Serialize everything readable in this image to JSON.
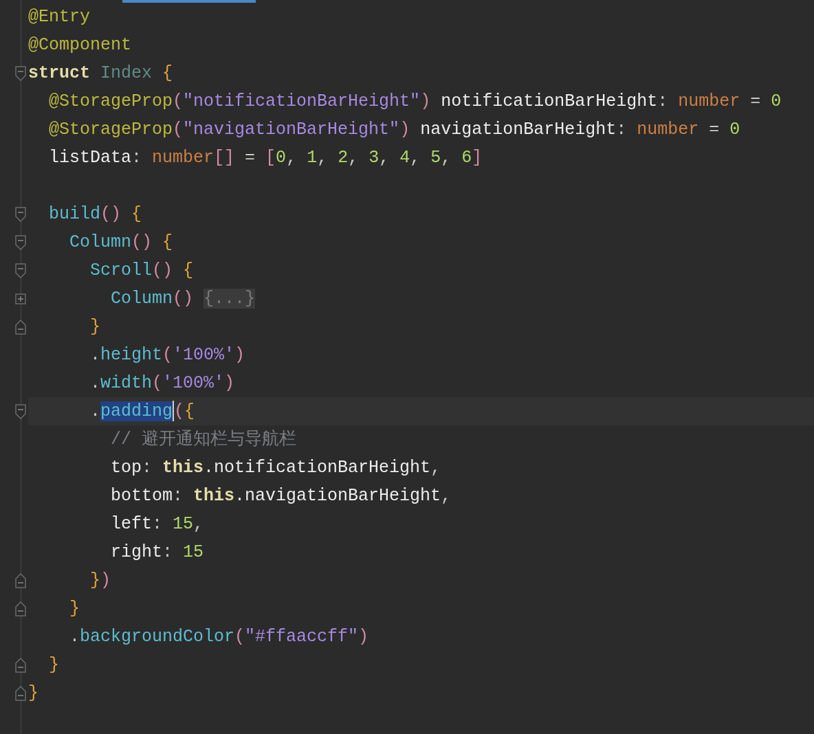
{
  "editor": {
    "lines": [
      {
        "kind": "plain",
        "current": false,
        "tokens": [
          {
            "text": "@Entry",
            "kind": "annotation"
          }
        ]
      },
      {
        "kind": "plain",
        "current": false,
        "tokens": [
          {
            "text": "@Component",
            "kind": "annotation"
          }
        ]
      },
      {
        "kind": "foldstart",
        "current": false,
        "tokens": [
          {
            "text": "struct",
            "kind": "keyword"
          },
          {
            "text": " Index ",
            "kind": "class"
          },
          {
            "text": "{",
            "kind": "brace"
          }
        ]
      },
      {
        "kind": "plain",
        "current": false,
        "tokens": [
          {
            "text": "  @StorageProp",
            "kind": "annotation"
          },
          {
            "text": "(",
            "kind": "paren"
          },
          {
            "text": "\"notificationBarHeight\"",
            "kind": "string"
          },
          {
            "text": ")",
            "kind": "paren"
          },
          {
            "text": " notificationBarHeight",
            "kind": "ident"
          },
          {
            "text": ": ",
            "kind": "punct"
          },
          {
            "text": "number",
            "kind": "type"
          },
          {
            "text": " = ",
            "kind": "punct"
          },
          {
            "text": "0",
            "kind": "number"
          }
        ]
      },
      {
        "kind": "plain",
        "current": false,
        "tokens": [
          {
            "text": "  @StorageProp",
            "kind": "annotation"
          },
          {
            "text": "(",
            "kind": "paren"
          },
          {
            "text": "\"navigationBarHeight\"",
            "kind": "string"
          },
          {
            "text": ")",
            "kind": "paren"
          },
          {
            "text": " navigationBarHeight",
            "kind": "ident"
          },
          {
            "text": ": ",
            "kind": "punct"
          },
          {
            "text": "number",
            "kind": "type"
          },
          {
            "text": " = ",
            "kind": "punct"
          },
          {
            "text": "0",
            "kind": "number"
          }
        ]
      },
      {
        "kind": "plain",
        "current": false,
        "tokens": [
          {
            "text": "  listData",
            "kind": "ident"
          },
          {
            "text": ": ",
            "kind": "punct"
          },
          {
            "text": "number",
            "kind": "type"
          },
          {
            "text": "[]",
            "kind": "paren"
          },
          {
            "text": " = ",
            "kind": "punct"
          },
          {
            "text": "[",
            "kind": "paren"
          },
          {
            "text": "0",
            "kind": "number"
          },
          {
            "text": ", ",
            "kind": "punct"
          },
          {
            "text": "1",
            "kind": "number"
          },
          {
            "text": ", ",
            "kind": "punct"
          },
          {
            "text": "2",
            "kind": "number"
          },
          {
            "text": ", ",
            "kind": "punct"
          },
          {
            "text": "3",
            "kind": "number"
          },
          {
            "text": ", ",
            "kind": "punct"
          },
          {
            "text": "4",
            "kind": "number"
          },
          {
            "text": ", ",
            "kind": "punct"
          },
          {
            "text": "5",
            "kind": "number"
          },
          {
            "text": ", ",
            "kind": "punct"
          },
          {
            "text": "6",
            "kind": "number"
          },
          {
            "text": "]",
            "kind": "paren"
          }
        ]
      },
      {
        "kind": "plain"
      },
      {
        "kind": "foldstart",
        "current": false,
        "tokens": [
          {
            "text": "  build",
            "kind": "function"
          },
          {
            "text": "()",
            "kind": "paren"
          },
          {
            "text": " {",
            "kind": "brace"
          }
        ]
      },
      {
        "kind": "foldstart",
        "current": false,
        "tokens": [
          {
            "text": "    Column",
            "kind": "function"
          },
          {
            "text": "()",
            "kind": "paren"
          },
          {
            "text": " {",
            "kind": "brace"
          }
        ]
      },
      {
        "kind": "foldstart",
        "current": false,
        "tokens": [
          {
            "text": "      Scroll",
            "kind": "function"
          },
          {
            "text": "()",
            "kind": "paren"
          },
          {
            "text": " {",
            "kind": "brace"
          }
        ]
      },
      {
        "kind": "collapsed",
        "current": false,
        "tokens": [
          {
            "text": "        Column",
            "kind": "function"
          },
          {
            "text": "() ",
            "kind": "paren"
          },
          {
            "text": "{...}",
            "kind": "folded"
          }
        ]
      },
      {
        "kind": "foldend",
        "current": false,
        "tokens": [
          {
            "text": "      }",
            "kind": "brace"
          }
        ]
      },
      {
        "kind": "plain",
        "current": false,
        "tokens": [
          {
            "text": "      .",
            "kind": "punct"
          },
          {
            "text": "height",
            "kind": "function"
          },
          {
            "text": "(",
            "kind": "paren"
          },
          {
            "text": "'100%'",
            "kind": "string"
          },
          {
            "text": ")",
            "kind": "paren"
          }
        ]
      },
      {
        "kind": "plain",
        "current": false,
        "tokens": [
          {
            "text": "      .",
            "kind": "punct"
          },
          {
            "text": "width",
            "kind": "function"
          },
          {
            "text": "(",
            "kind": "paren"
          },
          {
            "text": "'100%'",
            "kind": "string"
          },
          {
            "text": ")",
            "kind": "paren"
          }
        ]
      },
      {
        "kind": "foldstart",
        "current": true,
        "tokens": [
          {
            "text": "      .",
            "kind": "punct"
          },
          {
            "text": "padding",
            "kind": "selection"
          },
          {
            "text": "(",
            "kind": "paren"
          },
          {
            "text": "{",
            "kind": "brace"
          }
        ]
      },
      {
        "kind": "plain",
        "current": false,
        "tokens": [
          {
            "text": "        // 避开通知栏与导航栏",
            "kind": "comment"
          }
        ]
      },
      {
        "kind": "plain",
        "current": false,
        "tokens": [
          {
            "text": "        top",
            "kind": "ident"
          },
          {
            "text": ": ",
            "kind": "punct"
          },
          {
            "text": "this",
            "kind": "keyword"
          },
          {
            "text": ".notificationBarHeight",
            "kind": "ident"
          },
          {
            "text": ",",
            "kind": "punct"
          }
        ]
      },
      {
        "kind": "plain",
        "current": false,
        "tokens": [
          {
            "text": "        bottom",
            "kind": "ident"
          },
          {
            "text": ": ",
            "kind": "punct"
          },
          {
            "text": "this",
            "kind": "keyword"
          },
          {
            "text": ".navigationBarHeight",
            "kind": "ident"
          },
          {
            "text": ",",
            "kind": "punct"
          }
        ]
      },
      {
        "kind": "plain",
        "current": false,
        "tokens": [
          {
            "text": "        left",
            "kind": "ident"
          },
          {
            "text": ": ",
            "kind": "punct"
          },
          {
            "text": "15",
            "kind": "number"
          },
          {
            "text": ",",
            "kind": "punct"
          }
        ]
      },
      {
        "kind": "plain",
        "current": false,
        "tokens": [
          {
            "text": "        right",
            "kind": "ident"
          },
          {
            "text": ": ",
            "kind": "punct"
          },
          {
            "text": "15",
            "kind": "number"
          }
        ]
      },
      {
        "kind": "foldend",
        "current": false,
        "tokens": [
          {
            "text": "      }",
            "kind": "brace"
          },
          {
            "text": ")",
            "kind": "paren"
          }
        ]
      },
      {
        "kind": "foldend",
        "current": false,
        "tokens": [
          {
            "text": "    }",
            "kind": "brace"
          }
        ]
      },
      {
        "kind": "plain",
        "current": false,
        "tokens": [
          {
            "text": "    .",
            "kind": "punct"
          },
          {
            "text": "backgroundColor",
            "kind": "function"
          },
          {
            "text": "(",
            "kind": "paren"
          },
          {
            "text": "\"#ffaaccff\"",
            "kind": "string"
          },
          {
            "text": ")",
            "kind": "paren"
          }
        ]
      },
      {
        "kind": "foldend",
        "current": false,
        "tokens": [
          {
            "text": "  }",
            "kind": "brace"
          }
        ]
      },
      {
        "kind": "foldend",
        "current": false,
        "tokens": [
          {
            "text": "}",
            "kind": "brace"
          }
        ]
      }
    ]
  }
}
